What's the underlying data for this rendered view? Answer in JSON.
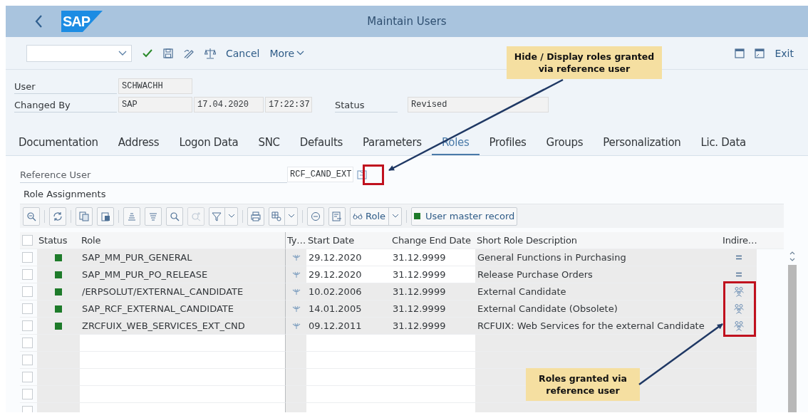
{
  "window": {
    "logo": "SAP",
    "title": "Maintain Users"
  },
  "toolbar": {
    "cancel": "Cancel",
    "more": "More",
    "exit": "Exit"
  },
  "header": {
    "user_label": "User",
    "user": "SCHWACHH",
    "changed_by_label": "Changed By",
    "changed_by": "SAP",
    "changed_date": "17.04.2020",
    "changed_time": "17:22:37",
    "status_label": "Status",
    "status": "Revised"
  },
  "tabs": [
    {
      "label": "Documentation",
      "selected": false
    },
    {
      "label": "Address",
      "selected": false
    },
    {
      "label": "Logon Data",
      "selected": false
    },
    {
      "label": "SNC",
      "selected": false
    },
    {
      "label": "Defaults",
      "selected": false
    },
    {
      "label": "Parameters",
      "selected": false
    },
    {
      "label": "Roles",
      "selected": true
    },
    {
      "label": "Profiles",
      "selected": false
    },
    {
      "label": "Groups",
      "selected": false
    },
    {
      "label": "Personalization",
      "selected": false
    },
    {
      "label": "Lic. Data",
      "selected": false
    }
  ],
  "reference_user": {
    "label": "Reference User",
    "value": "RCF_CAND_EXT"
  },
  "role_assignments": {
    "title": "Role Assignments",
    "role_button": "Role",
    "master_record_button": "User master record"
  },
  "table": {
    "select_all": {
      "checked": false
    },
    "columns": [
      "Status",
      "Role",
      "Ty…",
      "Start Date",
      "Change End Date",
      "Short Role Description",
      "Indire…"
    ],
    "rows": [
      {
        "selected": false,
        "color": "#1e7b2a",
        "role": "SAP_MM_PUR_GENERAL",
        "start": "29.12.2020",
        "end": "31.12.9999",
        "description": "General Functions in Purchasing",
        "kind": "direct",
        "editable": true
      },
      {
        "selected": false,
        "color": "#1e7b2a",
        "role": "SAP_MM_PUR_PO_RELEASE",
        "start": "29.12.2020",
        "end": "31.12.9999",
        "description": "Release Purchase Orders",
        "kind": "direct",
        "editable": true
      },
      {
        "selected": false,
        "color": "#1e7b2a",
        "role": "/ERPSOLUT/EXTERNAL_CANDIDATE",
        "start": "10.02.2006",
        "end": "31.12.9999",
        "description": "External Candidate",
        "kind": "reference",
        "editable": false
      },
      {
        "selected": false,
        "color": "#1e7b2a",
        "role": "SAP_RCF_EXTERNAL_CANDIDATE",
        "start": "14.01.2005",
        "end": "31.12.9999",
        "description": "External Candidate (Obsolete)",
        "kind": "reference",
        "editable": false
      },
      {
        "selected": false,
        "color": "#1e7b2a",
        "role": "ZRCFUIX_WEB_SERVICES_EXT_CND",
        "start": "09.12.2011",
        "end": "31.12.9999",
        "description": "RCFUIX: Web Services for the external Candidate",
        "kind": "reference",
        "editable": false
      }
    ],
    "blank_rows": [
      {
        "selected": false
      },
      {
        "selected": false
      },
      {
        "selected": false
      },
      {
        "selected": false
      },
      {
        "selected": false
      }
    ]
  },
  "callouts": [
    {
      "text": "Hide / Display roles granted via reference user"
    },
    {
      "text": "Roles granted via reference user"
    }
  ]
}
